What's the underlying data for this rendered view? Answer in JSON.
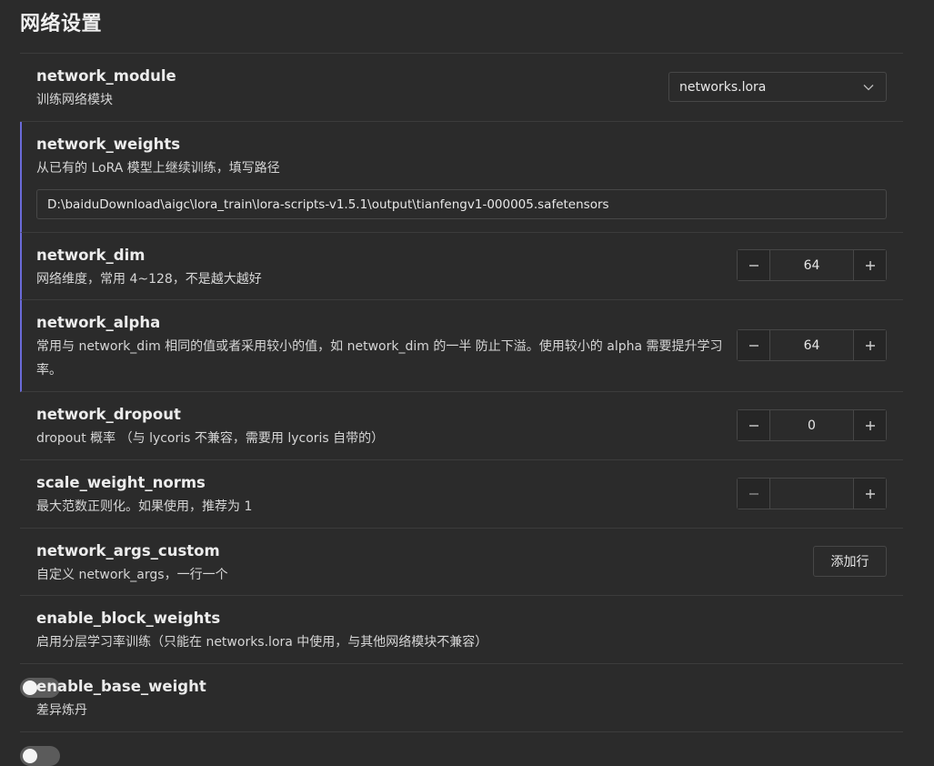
{
  "section": {
    "title": "网络设置"
  },
  "rows": [
    {
      "name": "network_module",
      "desc": "训练网络模块",
      "control": "select",
      "value": "networks.lora"
    },
    {
      "name": "network_weights",
      "desc": "从已有的 LoRA 模型上继续训练，填写路径",
      "control": "text",
      "value": "D:\\baiduDownload\\aigc\\lora_train\\lora-scripts-v1.5.1\\output\\tianfengv1-000005.safetensors"
    },
    {
      "name": "network_dim",
      "desc": "网络维度，常用 4~128，不是越大越好",
      "control": "number",
      "value": "64"
    },
    {
      "name": "network_alpha",
      "desc": "常用与 network_dim 相同的值或者采用较小的值，如 network_dim 的一半 防止下溢。使用较小的 alpha 需要提升学习率。",
      "control": "number",
      "value": "64"
    },
    {
      "name": "network_dropout",
      "desc": "dropout 概率 （与 lycoris 不兼容，需要用 lycoris 自带的）",
      "control": "number",
      "value": "0"
    },
    {
      "name": "scale_weight_norms",
      "desc": "最大范数正则化。如果使用，推荐为 1",
      "control": "number",
      "value": ""
    },
    {
      "name": "network_args_custom",
      "desc": "自定义 network_args，一行一个",
      "control": "button",
      "button_label": "添加行"
    },
    {
      "name": "enable_block_weights",
      "desc": "启用分层学习率训练（只能在 networks.lora 中使用，与其他网络模块不兼容）",
      "control": "toggle",
      "value": false
    },
    {
      "name": "enable_base_weight",
      "desc": "差异炼丹",
      "control": "toggle",
      "value": false
    }
  ],
  "icons": {
    "select_arrow": "chevron-down-icon",
    "decrement": "minus-icon",
    "increment": "plus-icon"
  },
  "colors": {
    "background": "#2b2b2b",
    "modified_marker": "#6a6ad8",
    "toggle_off": "#5b5b5b"
  }
}
